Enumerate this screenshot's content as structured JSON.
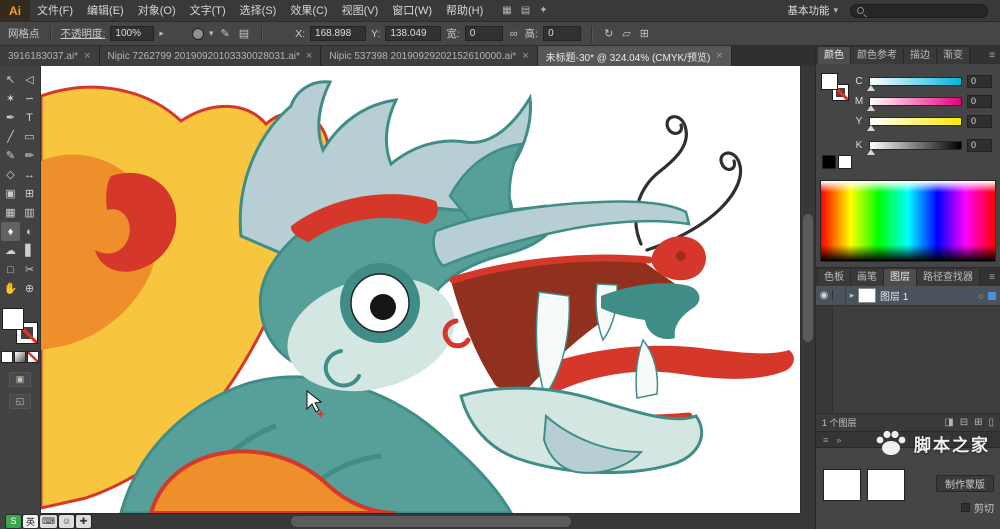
{
  "menubar": {
    "logo": "Ai",
    "items": [
      {
        "name": "menu-file",
        "label": "文件(F)"
      },
      {
        "name": "menu-edit",
        "label": "编辑(E)"
      },
      {
        "name": "menu-object",
        "label": "对象(O)"
      },
      {
        "name": "menu-type",
        "label": "文字(T)"
      },
      {
        "name": "menu-select",
        "label": "选择(S)"
      },
      {
        "name": "menu-effect",
        "label": "效果(C)"
      },
      {
        "name": "menu-view",
        "label": "视图(V)"
      },
      {
        "name": "menu-window",
        "label": "窗口(W)"
      },
      {
        "name": "menu-help",
        "label": "帮助(H)"
      }
    ],
    "icons": [
      {
        "name": "bridge-icon",
        "glyph": "▦"
      },
      {
        "name": "arrange-documents-icon",
        "glyph": "▤"
      },
      {
        "name": "cs-live-icon",
        "glyph": "✦"
      }
    ],
    "workspace": {
      "label": "基本功能",
      "chevron": "▾"
    }
  },
  "controlbar": {
    "context_label": "网格点",
    "opacity_label": "不透明度:",
    "opacity_value": "100%",
    "opacity_chevron": "▸",
    "style_chevron": "▾",
    "brush_icon": "✎",
    "doc_icon": "▤",
    "x_label": "X:",
    "x_value": "168.898",
    "y_label": "Y:",
    "y_value": "138.049",
    "w_label": "宽:",
    "w_value": "0",
    "link_icon": "∞",
    "h_label": "高:",
    "h_value": "0",
    "rotate_icon": "↻",
    "shear_icon": "▱",
    "grid_icon": "⊞"
  },
  "doctabs": [
    {
      "name": "doc-tab-1",
      "title": "3916183037.ai*",
      "close": "×",
      "active": false
    },
    {
      "name": "doc-tab-2",
      "title": "Nipic 7262799 20190920103330028031.ai*",
      "close": "×",
      "active": false
    },
    {
      "name": "doc-tab-3",
      "title": "Nipic 537398 20190929202152610000.ai*",
      "close": "×",
      "active": false
    },
    {
      "name": "doc-tab-4",
      "title": "未标题-30* @ 324.04% (CMYK/预览)",
      "close": "×",
      "active": true
    }
  ],
  "toolbar": {
    "tools": [
      {
        "name": "selection-tool",
        "glyph": "↖",
        "active": false
      },
      {
        "name": "direct-selection-tool",
        "glyph": "◁",
        "active": false
      },
      {
        "name": "magic-wand-tool",
        "glyph": "✶",
        "active": false
      },
      {
        "name": "lasso-tool",
        "glyph": "∽",
        "active": false
      },
      {
        "name": "pen-tool",
        "glyph": "✒",
        "active": false
      },
      {
        "name": "type-tool",
        "glyph": "T",
        "active": false
      },
      {
        "name": "line-segment-tool",
        "glyph": "╱",
        "active": false
      },
      {
        "name": "rectangle-tool",
        "glyph": "▭",
        "active": false
      },
      {
        "name": "paintbrush-tool",
        "glyph": "✎",
        "active": false
      },
      {
        "name": "pencil-tool",
        "glyph": "✏",
        "active": false
      },
      {
        "name": "width-tool",
        "glyph": "◇",
        "active": false
      },
      {
        "name": "free-transform-tool",
        "glyph": "↔",
        "active": false
      },
      {
        "name": "shape-builder-tool",
        "glyph": "▣",
        "active": false
      },
      {
        "name": "perspective-grid-tool",
        "glyph": "⊞",
        "active": false
      },
      {
        "name": "mesh-tool",
        "glyph": "▦",
        "active": false
      },
      {
        "name": "gradient-tool",
        "glyph": "▥",
        "active": false
      },
      {
        "name": "eyedropper-tool",
        "glyph": "♦",
        "active": true
      },
      {
        "name": "blend-tool",
        "glyph": "◐",
        "active": false
      },
      {
        "name": "symbol-sprayer-tool",
        "glyph": "☁",
        "active": false
      },
      {
        "name": "column-graph-tool",
        "glyph": "▋",
        "active": false
      },
      {
        "name": "artboard-tool",
        "glyph": "□",
        "active": false
      },
      {
        "name": "slice-tool",
        "glyph": "✂",
        "active": false
      },
      {
        "name": "hand-tool",
        "glyph": "✋",
        "active": false
      },
      {
        "name": "zoom-tool",
        "glyph": "⊕",
        "active": false
      }
    ],
    "mode_icons": [
      {
        "name": "drawing-mode-icon",
        "glyph": "▣"
      },
      {
        "name": "screen-mode-icon",
        "glyph": "◱"
      }
    ]
  },
  "right_panel": {
    "panel_menu_icon": "≡",
    "color_panel": {
      "tabs": [
        {
          "name": "tab-color",
          "label": "颜色",
          "active": true
        },
        {
          "name": "tab-color-guide",
          "label": "颜色参考",
          "active": false
        },
        {
          "name": "tab-stroke",
          "label": "描边",
          "active": false
        },
        {
          "name": "tab-gradient",
          "label": "渐变",
          "active": false
        }
      ],
      "channels": [
        {
          "name": "C",
          "value": "0",
          "from": "#ffffff",
          "to": "#00b5e2"
        },
        {
          "name": "M",
          "value": "0",
          "from": "#ffffff",
          "to": "#e6007e"
        },
        {
          "name": "Y",
          "value": "0",
          "from": "#ffffff",
          "to": "#ffe800"
        },
        {
          "name": "K",
          "value": "0",
          "from": "#ffffff",
          "to": "#000000"
        }
      ]
    },
    "panel_tabs": [
      {
        "name": "tab-swatches",
        "label": "色板",
        "active": false
      },
      {
        "name": "tab-brushes",
        "label": "画笔",
        "active": false
      },
      {
        "name": "tab-layers",
        "label": "图层",
        "active": true
      },
      {
        "name": "tab-pathfinder",
        "label": "路径查找器",
        "active": false
      }
    ],
    "layers": {
      "visibility_icon": "◉",
      "expand_icon": "▸",
      "target_icon": "○",
      "rows": [
        {
          "name": "layer-row-1",
          "label": "图层 1"
        }
      ],
      "status": "1 个图层",
      "action_icons": [
        {
          "name": "make-clip-mask-icon",
          "glyph": "◨"
        },
        {
          "name": "new-sublayer-icon",
          "glyph": "⊟"
        },
        {
          "name": "new-layer-icon",
          "glyph": "⊞"
        },
        {
          "name": "delete-layer-icon",
          "glyph": "▯"
        }
      ]
    },
    "dock_icons": [
      {
        "name": "panel-dock-menu-icon",
        "glyph": "≡"
      },
      {
        "name": "collapse-panels-icon",
        "glyph": "»"
      }
    ],
    "transparency": {
      "make_mask_label": "制作蒙版",
      "clip_label": "剪切"
    },
    "watermark_text": "脚本之家"
  },
  "ime": {
    "chips": [
      {
        "name": "ime-logo-icon",
        "glyph": "S",
        "bg": "#3aa54d",
        "fg": "#ffffff"
      },
      {
        "name": "ime-lang-toggle",
        "glyph": "英",
        "bg": "#f2f2f2",
        "fg": "#222222"
      },
      {
        "name": "ime-keyboard-icon",
        "glyph": "⌨",
        "bg": "#dcdcdc",
        "fg": "#333333"
      },
      {
        "name": "ime-emoji-icon",
        "glyph": "☺",
        "bg": "#dcdcdc",
        "fg": "#333333"
      },
      {
        "name": "ime-toolbox-icon",
        "glyph": "✚",
        "bg": "#dcdcdc",
        "fg": "#333333"
      }
    ]
  },
  "artwork": {
    "palette": {
      "teal": "#57a09a",
      "tealDark": "#3f8d86",
      "mint": "#d3e6e2",
      "paleBlue": "#b7cfd4",
      "yellow": "#f8c53f",
      "orange": "#ee8f2b",
      "red": "#d5382a",
      "redDark": "#a32c1c",
      "maroon": "#92301f",
      "line": "#303030"
    }
  }
}
